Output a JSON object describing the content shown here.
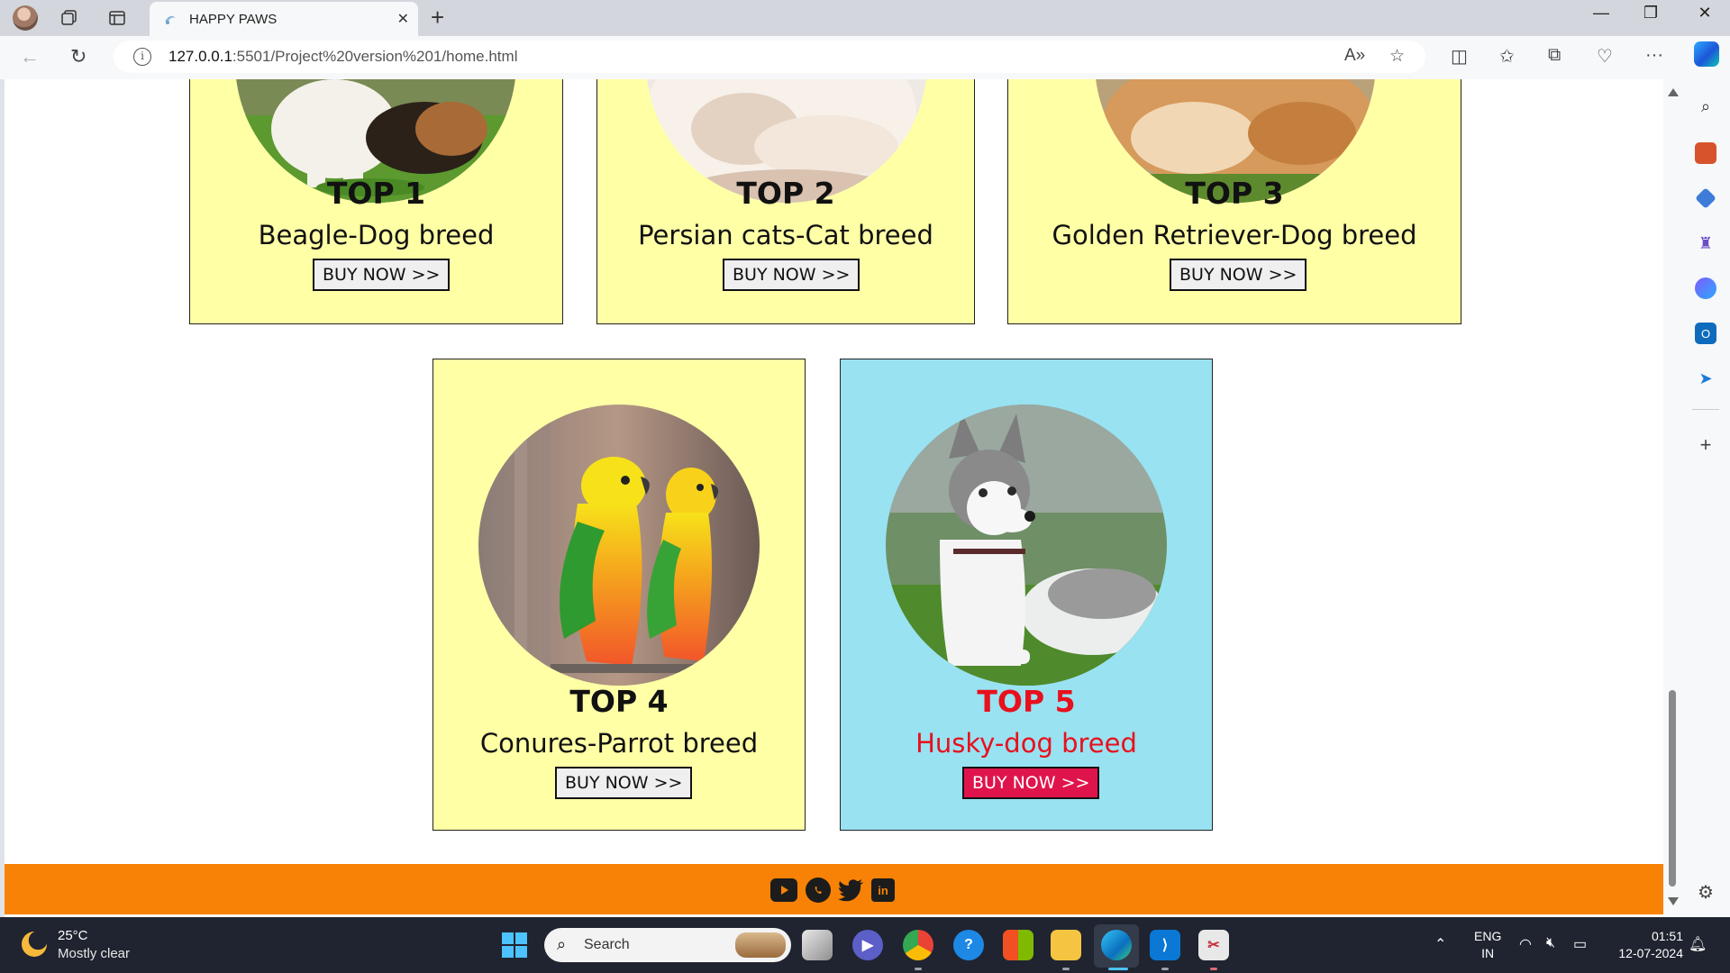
{
  "browser": {
    "tab_title": "HAPPY PAWS",
    "url_host": "127.0.0.1",
    "url_rest": ":5501/Project%20version%201/home.html"
  },
  "cards": [
    {
      "rank": "TOP 1",
      "breed": "Beagle-Dog breed",
      "button": "BUY NOW >>"
    },
    {
      "rank": "TOP 2",
      "breed": "Persian cats-Cat breed",
      "button": "BUY NOW >>"
    },
    {
      "rank": "TOP 3",
      "breed": "Golden Retriever-Dog breed",
      "button": "BUY NOW >>"
    },
    {
      "rank": "TOP 4",
      "breed": "Conures-Parrot breed",
      "button": "BUY NOW >>"
    },
    {
      "rank": "TOP 5",
      "breed": "Husky-dog breed",
      "button": "BUY NOW >>"
    }
  ],
  "colors": {
    "card_bg": "#ffffa6",
    "featured_bg": "#99e2f1",
    "featured_text": "#e8101d",
    "featured_button": "#e0144c",
    "footer_bg": "#f88205"
  },
  "footer": {
    "social_icons": [
      "youtube-icon",
      "whatsapp-icon",
      "twitter-icon",
      "linkedin-icon"
    ]
  },
  "taskbar": {
    "temperature": "25°C",
    "weather": "Mostly clear",
    "search_placeholder": "Search",
    "lang_line1": "ENG",
    "lang_line2": "IN",
    "time": "01:51",
    "date": "12-07-2024"
  }
}
